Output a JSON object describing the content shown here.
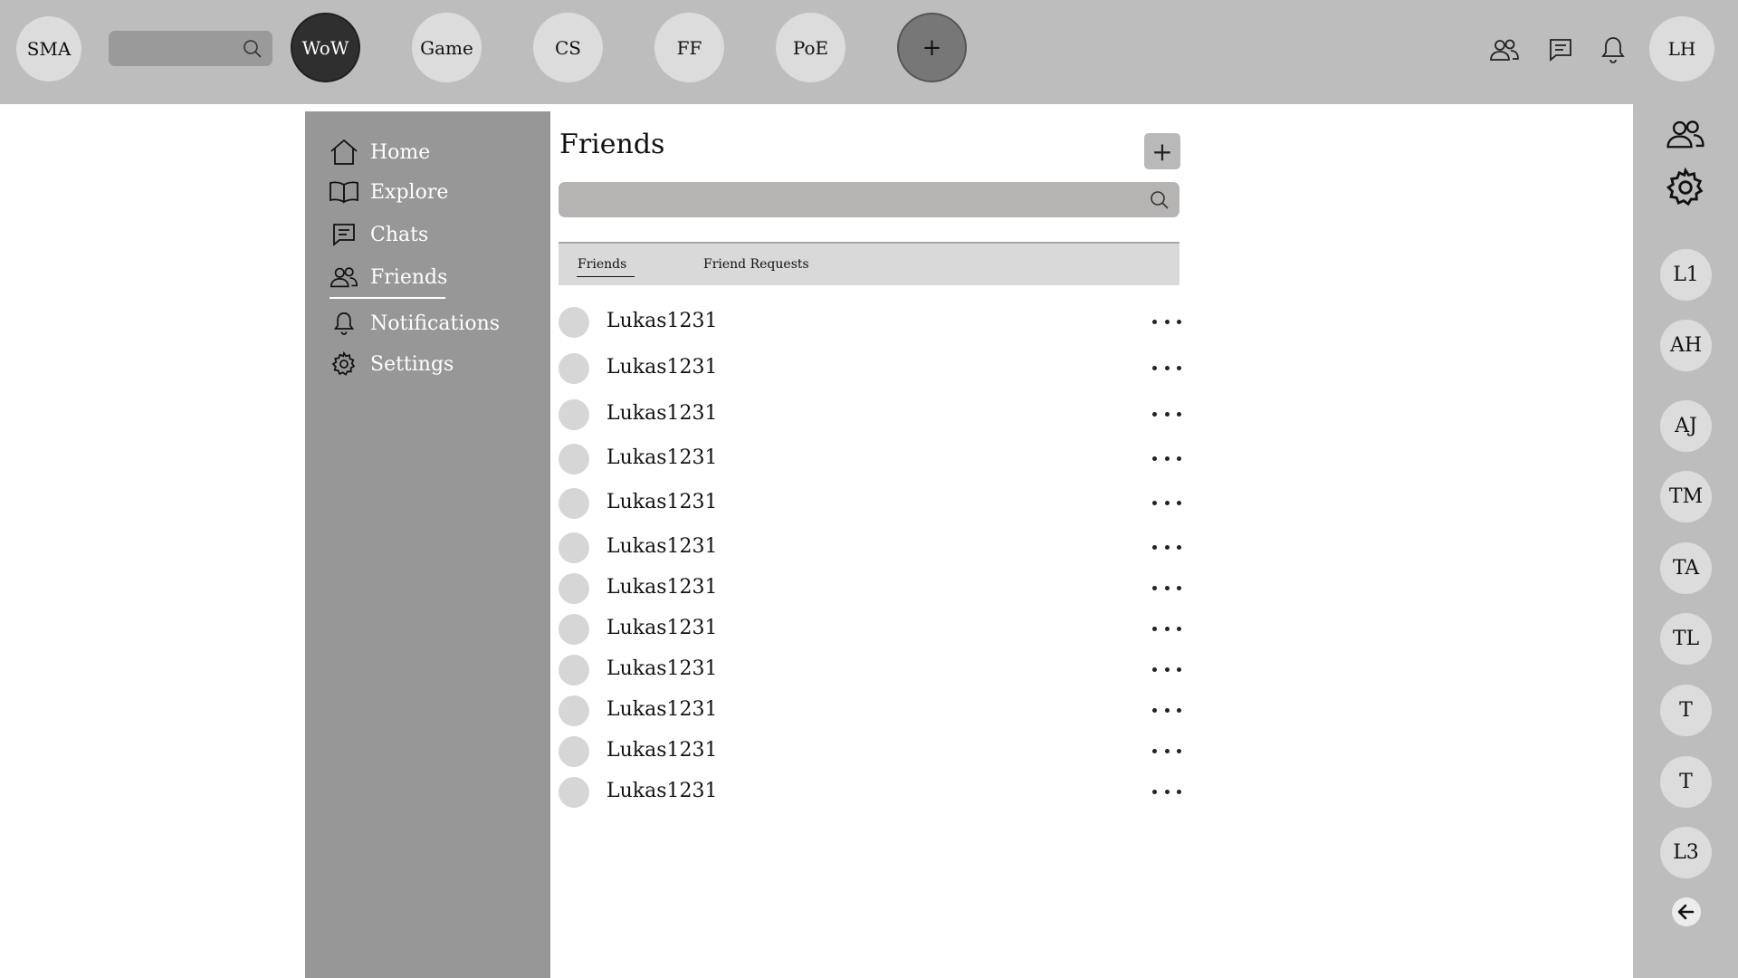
{
  "topbar": {
    "logo": "SMA",
    "search_placeholder": "",
    "games": [
      "WoW",
      "Game",
      "CS",
      "FF",
      "PoE"
    ],
    "add_game_label": "+",
    "user_initials": "LH",
    "icons": [
      "friends-icon",
      "chat-icon",
      "bell-icon"
    ]
  },
  "sidebar": {
    "items": [
      {
        "label": "Home",
        "icon": "home-icon"
      },
      {
        "label": "Explore",
        "icon": "book-icon"
      },
      {
        "label": "Chats",
        "icon": "chat-icon"
      },
      {
        "label": "Friends",
        "icon": "friends-icon",
        "active": true
      },
      {
        "label": "Notifications",
        "icon": "bell-icon"
      },
      {
        "label": "Settings",
        "icon": "gear-icon"
      }
    ]
  },
  "friends_panel": {
    "title": "Friends",
    "add_label": "+",
    "search_placeholder": "",
    "tabs": [
      {
        "label": "Friends",
        "active": true
      },
      {
        "label": "Friend Requests",
        "active": false
      }
    ],
    "friends": [
      "Lukas1231",
      "Lukas1231",
      "Lukas1231",
      "Lukas1231",
      "Lukas1231",
      "Lukas1231",
      "Lukas1231",
      "Lukas1231",
      "Lukas1231",
      "Lukas1231",
      "Lukas1231",
      "Lukas1231"
    ]
  },
  "rightbar": {
    "icons": [
      "friends-icon",
      "gear-icon"
    ],
    "members": [
      "L1",
      "AH",
      "AJ",
      "TM",
      "TA",
      "TL",
      "T",
      "T",
      "L3"
    ],
    "collapse_icon": "arrow-left-icon"
  },
  "colors": {
    "topbar_bg": "#bdbdbd",
    "sidebar_bg": "#979797",
    "active_game": "#2f2f2f",
    "avatar_bg": "#dcdcdc"
  }
}
